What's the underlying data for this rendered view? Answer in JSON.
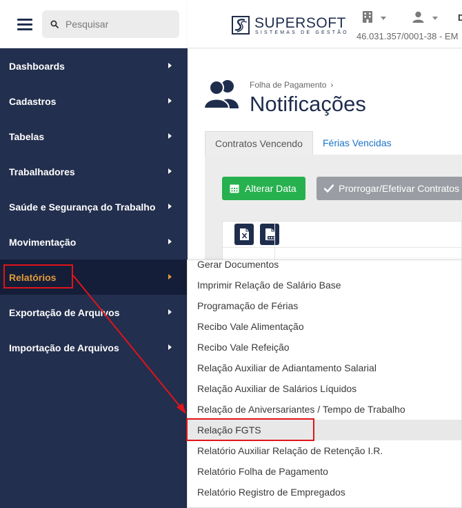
{
  "search": {
    "placeholder": "Pesquisar"
  },
  "sidebar": {
    "items": [
      {
        "label": "Dashboards"
      },
      {
        "label": "Cadastros"
      },
      {
        "label": "Tabelas"
      },
      {
        "label": "Trabalhadores"
      },
      {
        "label": "Saúde e Segurança do Trabalho"
      },
      {
        "label": "Movimentação"
      },
      {
        "label": "Relatórios",
        "active": true
      },
      {
        "label": "Exportação de Arquivos"
      },
      {
        "label": "Importação de Arquivos"
      }
    ]
  },
  "header": {
    "logo_name": "SUPERSOFT",
    "logo_subtitle": "SISTEMAS DE GESTÃO",
    "extra_text": "D",
    "cnpj": "46.031.357/0001-38 - EM"
  },
  "page": {
    "breadcrumb": "Folha de Pagamento",
    "breadcrumb_chevron": "›",
    "title": "Notificações"
  },
  "tabs": [
    {
      "label": "Contratos Vencendo",
      "active": true
    },
    {
      "label": "Férias Vencidas",
      "active": false
    }
  ],
  "toolbar": {
    "alterar_label": "Alterar Data",
    "prorrogar_label": "Prorrogar/Efetivar Contratos"
  },
  "dropdown": {
    "items": [
      {
        "label": "Gerar Documentos"
      },
      {
        "label": "Imprimir Relação de Salário Base"
      },
      {
        "label": "Programação de Férias"
      },
      {
        "label": "Recibo Vale Alimentação"
      },
      {
        "label": "Recibo Vale Refeição"
      },
      {
        "label": "Relação Auxiliar de Adiantamento Salarial"
      },
      {
        "label": "Relação Auxiliar de Salários Líquidos"
      },
      {
        "label": "Relação de Aniversariantes / Tempo de Trabalho"
      },
      {
        "label": "Relação FGTS",
        "highlighted": true
      },
      {
        "label": "Relatório Auxiliar Relação de Retenção I.R."
      },
      {
        "label": "Relatório Folha de Pagamento"
      },
      {
        "label": "Relatório Registro de Empregados"
      }
    ]
  },
  "colors": {
    "sidebar_bg": "#232f4e",
    "sidebar_active_bg": "#151e38",
    "active_text": "#e09a3c",
    "brand_navy": "#1f2d4d",
    "success_green": "#27b04e",
    "annotation_red": "#e0141b"
  }
}
